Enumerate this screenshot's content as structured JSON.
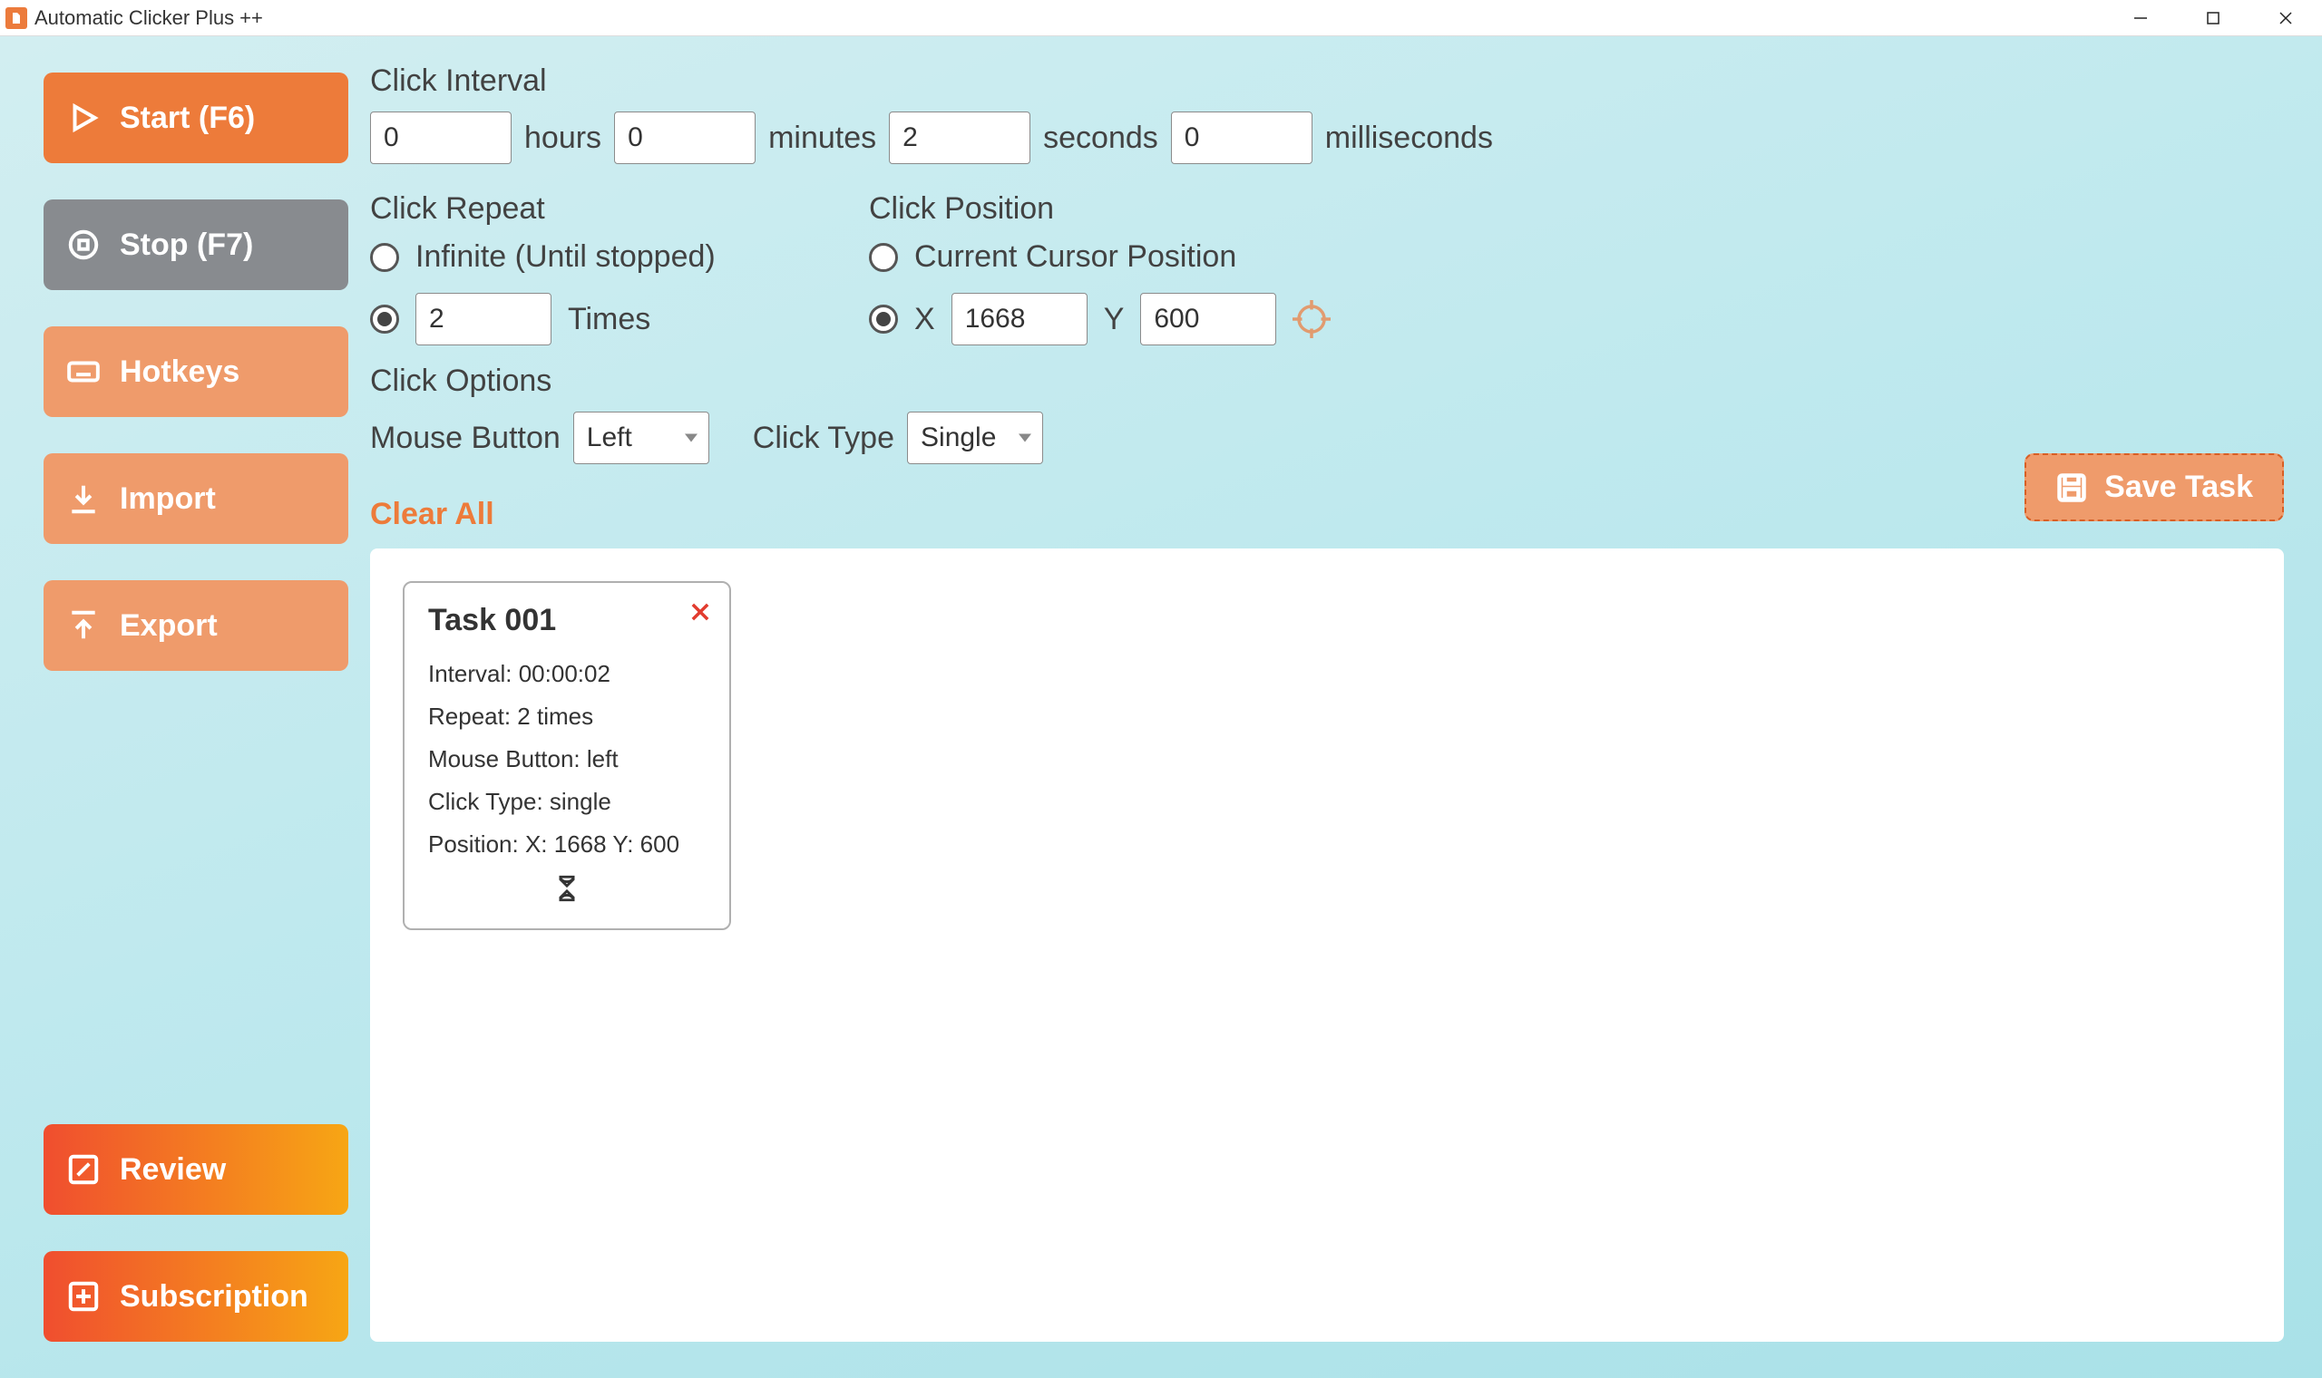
{
  "window": {
    "title": "Automatic Clicker Plus ++"
  },
  "sidebar": {
    "start": "Start (F6)",
    "stop": "Stop (F7)",
    "hotkeys": "Hotkeys",
    "import": "Import",
    "export": "Export",
    "review": "Review",
    "subscription": "Subscription"
  },
  "interval": {
    "heading": "Click Interval",
    "hours_value": "0",
    "hours_label": "hours",
    "minutes_value": "0",
    "minutes_label": "minutes",
    "seconds_value": "2",
    "seconds_label": "seconds",
    "ms_value": "0",
    "ms_label": "milliseconds"
  },
  "repeat": {
    "heading": "Click Repeat",
    "infinite_label": "Infinite (Until stopped)",
    "times_value": "2",
    "times_label": "Times"
  },
  "position": {
    "heading": "Click Position",
    "current_label": "Current Cursor Position",
    "x_label": "X",
    "x_value": "1668",
    "y_label": "Y",
    "y_value": "600"
  },
  "options": {
    "heading": "Click Options",
    "mouse_label": "Mouse Button",
    "mouse_value": "Left",
    "type_label": "Click Type",
    "type_value": "Single"
  },
  "actions": {
    "clear_all": "Clear All",
    "save_task": "Save Task"
  },
  "tasks": [
    {
      "title": "Task 001",
      "interval": "Interval: 00:00:02",
      "repeat": "Repeat: 2 times",
      "mouse": "Mouse Button: left",
      "type": "Click Type: single",
      "position": "Position: X: 1668 Y: 600"
    }
  ]
}
